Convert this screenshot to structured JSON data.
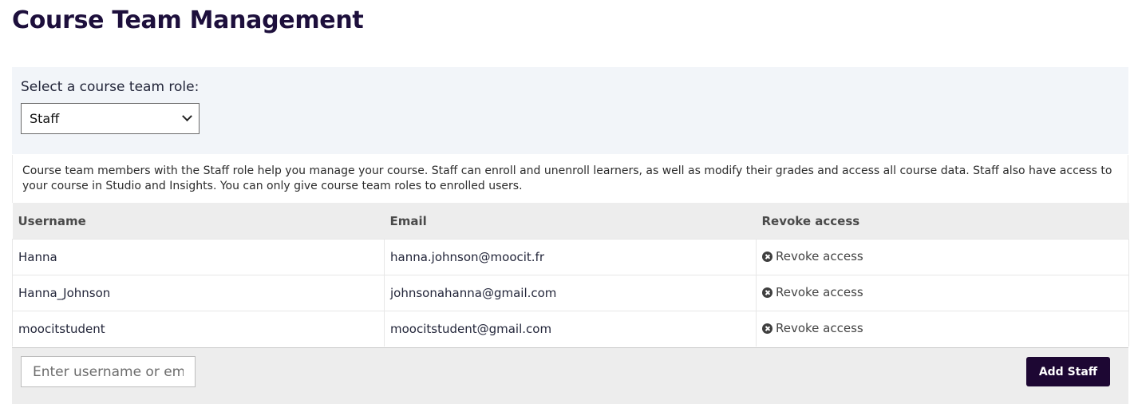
{
  "page": {
    "title": "Course Team Management"
  },
  "role_selector": {
    "label": "Select a course team role:",
    "selected": "Staff"
  },
  "description": "Course team members with the Staff role help you manage your course. Staff can enroll and unenroll learners, as well as modify their grades and access all course data. Staff also have access to your course in Studio and Insights. You can only give course team roles to enrolled users.",
  "table": {
    "headers": {
      "username": "Username",
      "email": "Email",
      "revoke": "Revoke access"
    },
    "rows": [
      {
        "username": "Hanna",
        "email": "hanna.johnson@moocit.fr",
        "action": "Revoke access"
      },
      {
        "username": "Hanna_Johnson",
        "email": "johnsonahanna@gmail.com",
        "action": "Revoke access"
      },
      {
        "username": "moocitstudent",
        "email": "moocitstudent@gmail.com",
        "action": "Revoke access"
      }
    ]
  },
  "add_member": {
    "placeholder": "Enter username or email",
    "button_label": "Add Staff"
  },
  "colors": {
    "title": "#1d0f3c",
    "primary_button": "#1d0733",
    "panel_background": "#f2f5f9",
    "table_header_background": "#ededed"
  },
  "icons": {
    "revoke": "times-circle-icon",
    "select": "chevron-down-icon"
  }
}
